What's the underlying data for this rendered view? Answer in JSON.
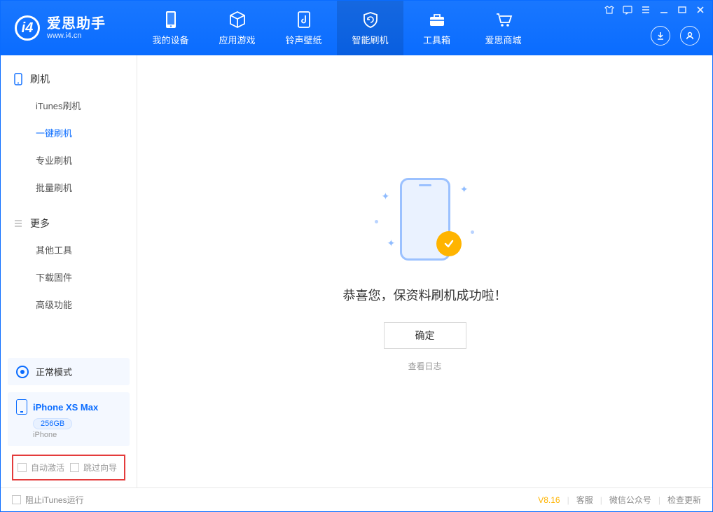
{
  "app": {
    "title": "爱思助手",
    "subtitle": "www.i4.cn"
  },
  "nav": {
    "tabs": [
      {
        "label": "我的设备"
      },
      {
        "label": "应用游戏"
      },
      {
        "label": "铃声壁纸"
      },
      {
        "label": "智能刷机"
      },
      {
        "label": "工具箱"
      },
      {
        "label": "爱思商城"
      }
    ],
    "active_index": 3
  },
  "sidebar": {
    "group1": {
      "title": "刷机",
      "items": [
        {
          "label": "iTunes刷机"
        },
        {
          "label": "一键刷机"
        },
        {
          "label": "专业刷机"
        },
        {
          "label": "批量刷机"
        }
      ],
      "active_index": 1
    },
    "group2": {
      "title": "更多",
      "items": [
        {
          "label": "其他工具"
        },
        {
          "label": "下载固件"
        },
        {
          "label": "高级功能"
        }
      ]
    },
    "mode": {
      "label": "正常模式"
    },
    "device": {
      "name": "iPhone XS Max",
      "storage": "256GB",
      "type": "iPhone"
    },
    "options": {
      "auto_activate": "自动激活",
      "skip_guide": "跳过向导"
    }
  },
  "main": {
    "success_text": "恭喜您，保资料刷机成功啦！",
    "ok_button": "确定",
    "view_log": "查看日志"
  },
  "footer": {
    "block_itunes": "阻止iTunes运行",
    "version": "V8.16",
    "links": {
      "support": "客服",
      "wechat": "微信公众号",
      "update": "检查更新"
    }
  }
}
